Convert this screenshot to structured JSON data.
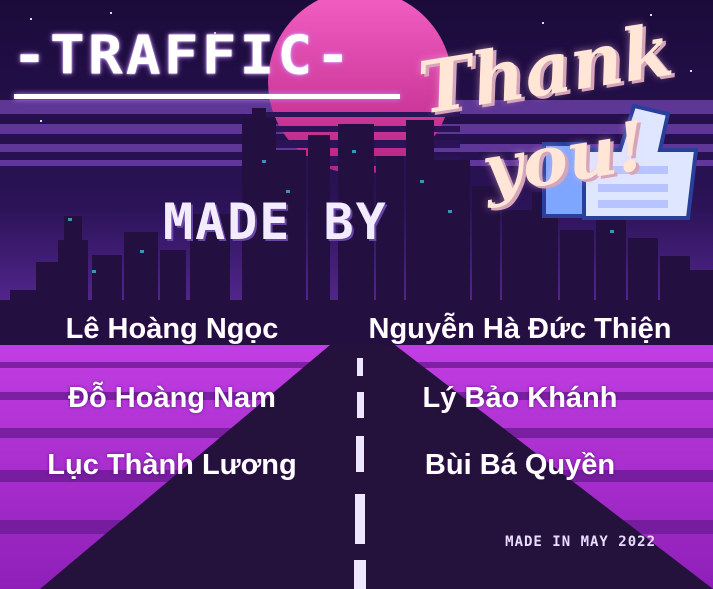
{
  "title": "-TRAFFIC-",
  "thank_you": {
    "line1": "Thank",
    "line2": "you!"
  },
  "made_by": "MADE BY",
  "credits": {
    "left": [
      "Lê Hoàng Ngọc",
      "Đỗ Hoàng Nam",
      "Lục Thành Lương"
    ],
    "right": [
      "Nguyễn Hà Đức Thiện",
      "Lý Bảo Khánh",
      "Bùi Bá Quyền"
    ]
  },
  "made_in": "MADE IN MAY 2022",
  "colors": {
    "sky_top": "#1b0b3a",
    "sky_purple": "#5b2a9a",
    "sun_top": "#e84fb5",
    "sun_bottom": "#c32a86",
    "city": "#241040",
    "ground_magenta": "#b52fd6",
    "road": "#24123c",
    "road_line": "#f0e8ff"
  },
  "icons": [
    "thumbs-up-icon",
    "sun-graphic",
    "city-skyline-graphic",
    "road-graphic"
  ]
}
